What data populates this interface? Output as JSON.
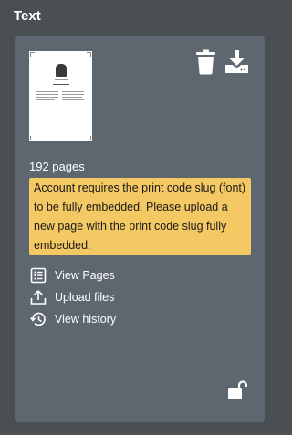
{
  "header": {
    "title": "Text"
  },
  "card": {
    "page_count": "192 pages",
    "warning": "Account requires the print code slug (font) to be fully embedded. Please upload a new page with the print code slug fully embedded.",
    "actions": [
      {
        "label": "View Pages",
        "icon": "list-icon"
      },
      {
        "label": "Upload files",
        "icon": "upload-icon"
      },
      {
        "label": "View history",
        "icon": "history-icon"
      }
    ],
    "toolbar_icons": [
      "trash-icon",
      "download-icon"
    ],
    "lock_icon": "unlock-icon"
  },
  "colors": {
    "background": "#4a4f54",
    "card": "#5e6770",
    "warning": "#f4c862",
    "text": "#ffffff"
  }
}
